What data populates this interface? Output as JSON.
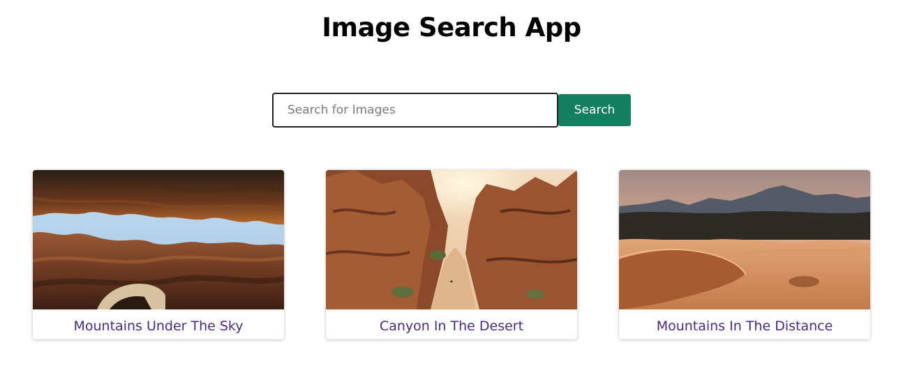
{
  "header": {
    "title": "Image Search App"
  },
  "search": {
    "placeholder": "Search for Images",
    "value": "",
    "button_label": "Search",
    "button_color": "#147f5f"
  },
  "results": [
    {
      "caption": "Mountains Under The Sky",
      "image": "canyon-sky-photo"
    },
    {
      "caption": "Canyon In The Desert",
      "image": "desert-canyon-photo"
    },
    {
      "caption": "Mountains In The Distance",
      "image": "sand-dunes-mountains-photo"
    }
  ],
  "colors": {
    "caption_text": "#4b2a7b"
  }
}
